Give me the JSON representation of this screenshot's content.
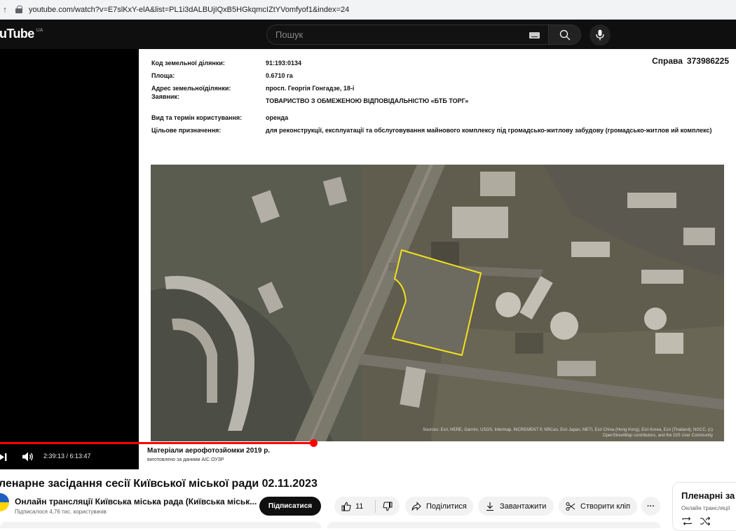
{
  "browser": {
    "url": "youtube.com/watch?v=E7slKxY-elA&list=PL1i3dALBUjIQxB5HGkqmcIZtYVomfyof1&index=24"
  },
  "header": {
    "logo_text": "uTube",
    "region": "UA",
    "search_placeholder": "Пошук"
  },
  "slide": {
    "case_label": "Справа",
    "case_number": "373986225",
    "rows": [
      {
        "label": "Код земельної ділянки:",
        "value": "91:193:0134"
      },
      {
        "label": "Площа:",
        "value": "0.6710 га"
      },
      {
        "label": "Адрес земельноїділянки:",
        "value": "просп. Георгія Гонгадзе, 18-і"
      },
      {
        "label": "Заявник:",
        "value": "ТОВАРИСТВО З ОБМЕЖЕНОЮ ВІДПОВІДАЛЬНІСТЮ «БТБ ТОРГ»"
      },
      {
        "label": "Вид та термін користування:",
        "value": "оренда"
      },
      {
        "label": "Цільове призначення:",
        "value": "для реконструкції, експлуатації та обслуговування майнового комплексу під громадсько-житлову забудову (громадсько-житлов ий комплекс)"
      }
    ],
    "photo_attribution": "Sources: Esri, HERE, Garmin, USGS, Intermap, INCREMENT P, NRCan, Esri Japan, METI, Esri China (Hong Kong), Esri Korea, Esri (Thailand), NGCC, (c) OpenStreetMap contributors, and the GIS User Community",
    "caption": "Матеріали аерофотозйомки 2019 р.",
    "caption_sub": "виготовлено за даними АІС ОУЗР"
  },
  "player": {
    "time": "2:39:13 / 6:13:47",
    "progress": 0.426
  },
  "video": {
    "title": "ленарне засідання сесії Київської міської ради 02.11.2023",
    "channel_name": "Онлайн трансляції Київська міська рада (Київська міськ...",
    "subscribers": "Підписалося 4,76 тис. користувачів",
    "subscribe_label": "Підписатися",
    "likes": "11",
    "share_label": "Поділитися",
    "download_label": "Завантажити",
    "clip_label": "Створити кліп",
    "more_label": "···"
  },
  "playlist": {
    "title": "Пленарні за",
    "subtitle": "Онлайн трансляції"
  }
}
